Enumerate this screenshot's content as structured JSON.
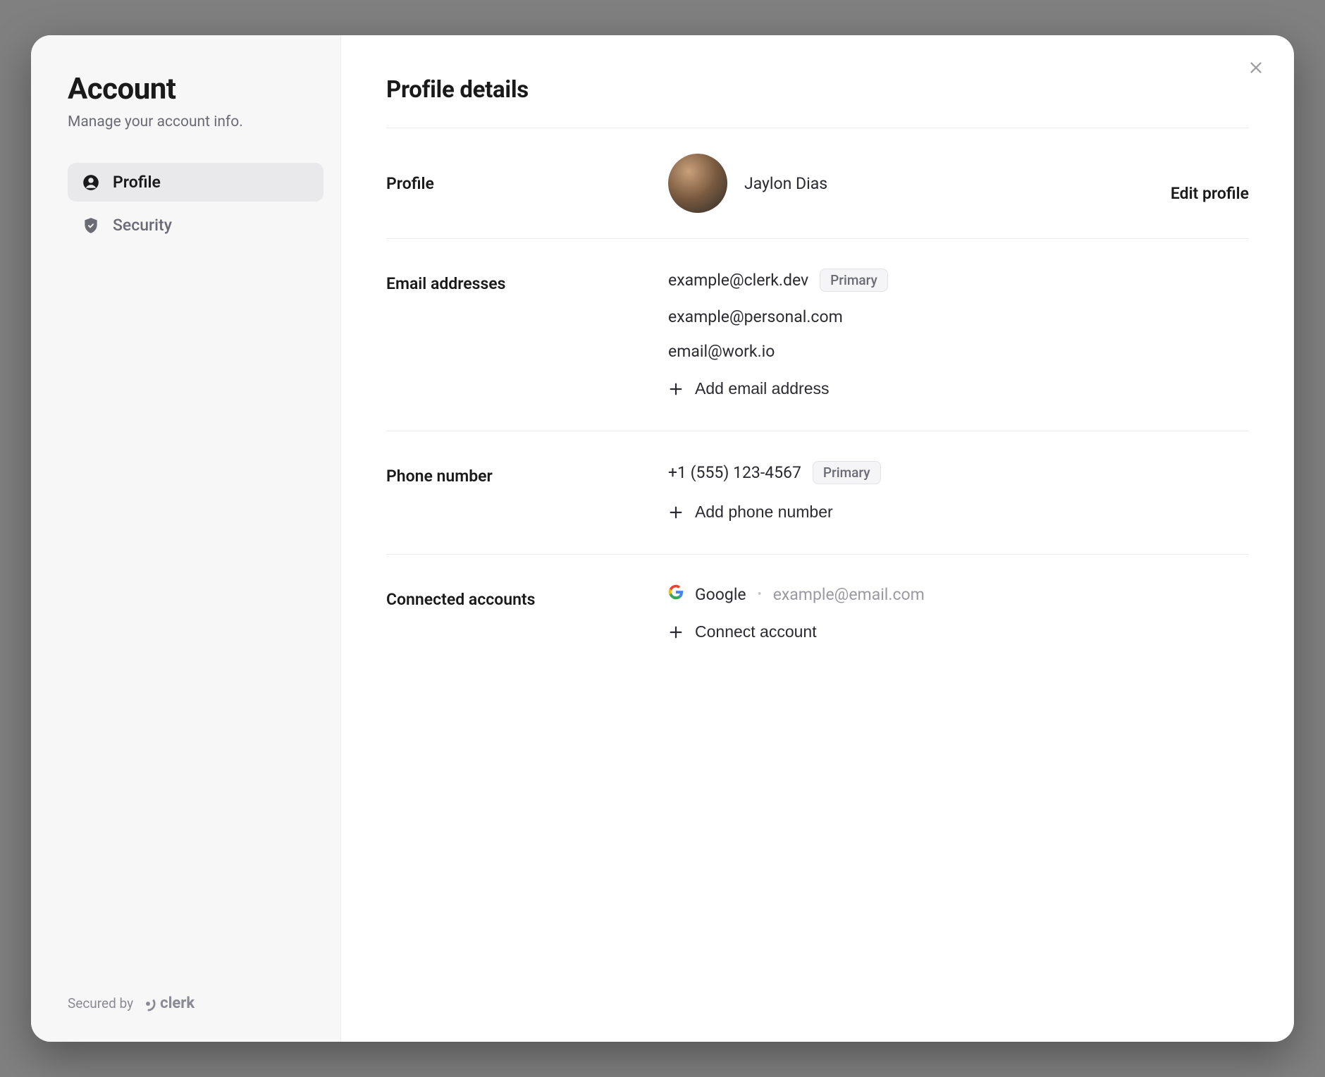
{
  "sidebar": {
    "title": "Account",
    "subtitle": "Manage your account info.",
    "nav": [
      {
        "label": "Profile",
        "icon": "user-circle-icon",
        "active": true
      },
      {
        "label": "Security",
        "icon": "shield-icon",
        "active": false
      }
    ],
    "secured_by": "Secured by",
    "brand": "clerk"
  },
  "main": {
    "title": "Profile details",
    "close_label": "Close",
    "sections": {
      "profile": {
        "label": "Profile",
        "name": "Jaylon Dias",
        "edit_label": "Edit profile"
      },
      "emails": {
        "label": "Email addresses",
        "items": [
          {
            "value": "example@clerk.dev",
            "primary_badge": "Primary"
          },
          {
            "value": "example@personal.com"
          },
          {
            "value": "email@work.io"
          }
        ],
        "add_label": "Add email address"
      },
      "phone": {
        "label": "Phone number",
        "items": [
          {
            "value": "+1 (555) 123-4567",
            "primary_badge": "Primary"
          }
        ],
        "add_label": "Add phone number"
      },
      "connected": {
        "label": "Connected accounts",
        "items": [
          {
            "provider_icon": "google-icon",
            "provider": "Google",
            "identifier": "example@email.com"
          }
        ],
        "add_label": "Connect account"
      }
    }
  }
}
